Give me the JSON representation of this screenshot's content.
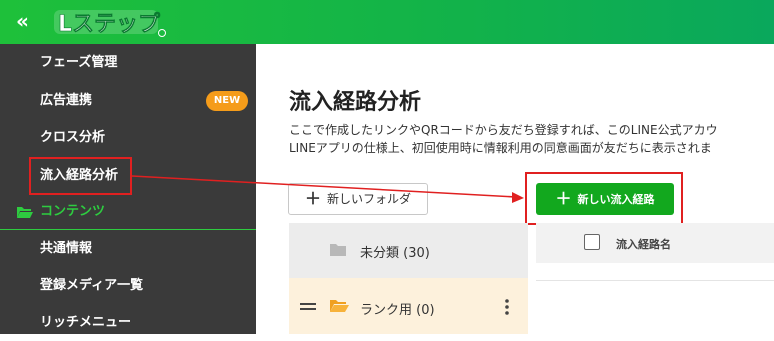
{
  "header": {
    "collapse_icon_glyph": "«",
    "logo_text": "Lステップ",
    "colors": {
      "bar": "#12b24a"
    }
  },
  "sidebar": {
    "items": [
      {
        "label": "フェーズ管理"
      },
      {
        "label": "広告連携",
        "badge": "NEW"
      },
      {
        "label": "クロス分析"
      },
      {
        "label": "流入経路分析"
      },
      {
        "label": "共通情報"
      },
      {
        "label": "登録メディア一覧"
      },
      {
        "label": "リッチメニュー"
      }
    ],
    "section": {
      "label": "コンテンツ",
      "icon": "folder-open-icon"
    }
  },
  "main": {
    "title": "流入経路分析",
    "description_line1": "ここで作成したリンクやQRコードから友だち登録すれば、このLINE公式アカウ",
    "description_line2": "LINEアプリの仕様上、初回使用時に情報利用の同意画面が友だちに表示されま",
    "new_folder_button": "新しいフォルダ",
    "new_route_button": "新しい流入経路",
    "folders": [
      {
        "name": "未分類 (30)"
      },
      {
        "name": "ランク用 (0)"
      }
    ],
    "table": {
      "column_name": "流入経路名"
    }
  },
  "colors": {
    "sidebar_bg": "#3a3a3a",
    "accent_green": "#12a81e",
    "badge_orange": "#f59c1a",
    "annotation_red": "#e02020"
  }
}
